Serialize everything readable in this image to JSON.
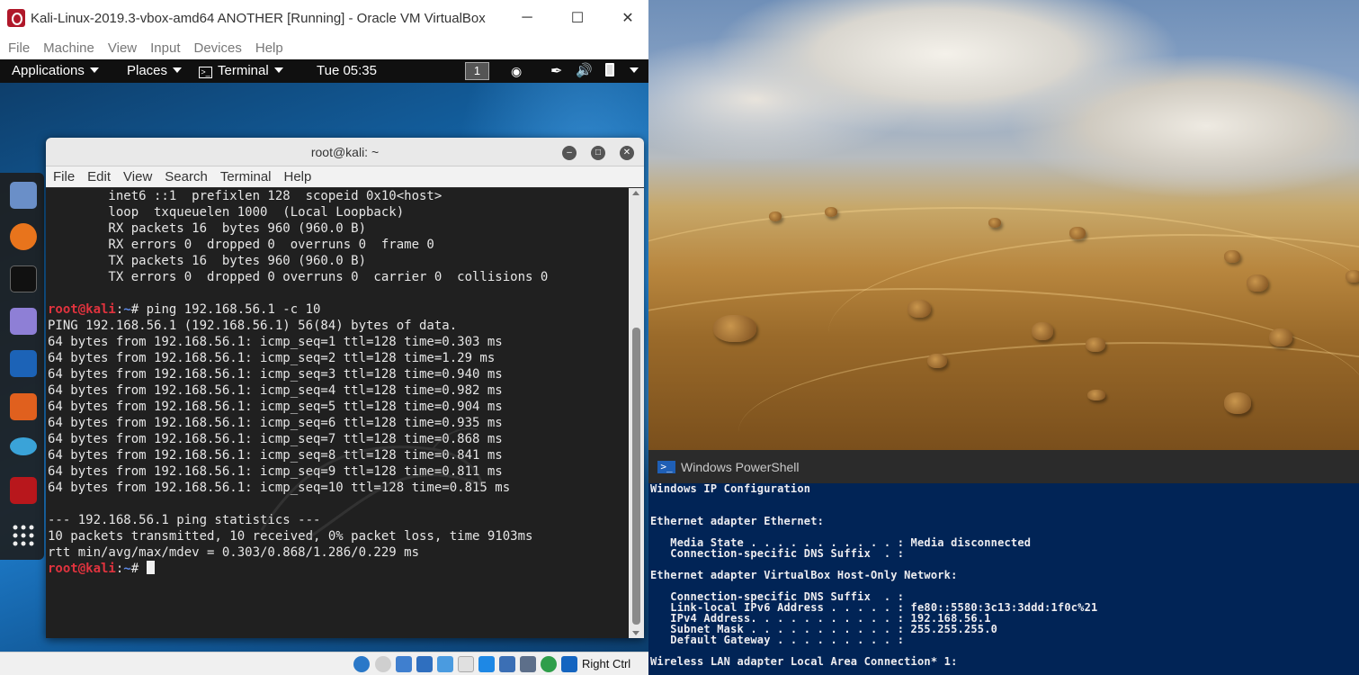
{
  "vbox": {
    "title": "Kali-Linux-2019.3-vbox-amd64 ANOTHER [Running] - Oracle VM VirtualBox",
    "window_controls": [
      "─",
      "☐",
      "✕"
    ],
    "menu": [
      "File",
      "Machine",
      "View",
      "Input",
      "Devices",
      "Help"
    ],
    "host_key": "Right Ctrl"
  },
  "kali_topbar": {
    "applications": "Applications",
    "places": "Places",
    "terminal": "Terminal",
    "clock": "Tue 05:35",
    "workspace": "1"
  },
  "dock": {
    "items": [
      "files-icon",
      "firefox-icon",
      "terminal-icon",
      "notes-icon",
      "metasploit-icon",
      "burpsuite-icon",
      "eye-icon",
      "cherrytree-icon",
      "app-grid-icon"
    ]
  },
  "terminal": {
    "title": "root@kali: ~",
    "menu": [
      "File",
      "Edit",
      "View",
      "Search",
      "Terminal",
      "Help"
    ],
    "lines_top": [
      "        inet6 ::1  prefixlen 128  scopeid 0x10<host>",
      "        loop  txqueuelen 1000  (Local Loopback)",
      "        RX packets 16  bytes 960 (960.0 B)",
      "        RX errors 0  dropped 0  overruns 0  frame 0",
      "        TX packets 16  bytes 960 (960.0 B)",
      "        TX errors 0  dropped 0 overruns 0  carrier 0  collisions 0",
      ""
    ],
    "prompt_user": "root@kali",
    "prompt_sep": ":",
    "prompt_path": "~",
    "prompt_symbol": "# ",
    "command": "ping 192.168.56.1 -c 10",
    "output": [
      "PING 192.168.56.1 (192.168.56.1) 56(84) bytes of data.",
      "64 bytes from 192.168.56.1: icmp_seq=1 ttl=128 time=0.303 ms",
      "64 bytes from 192.168.56.1: icmp_seq=2 ttl=128 time=1.29 ms",
      "64 bytes from 192.168.56.1: icmp_seq=3 ttl=128 time=0.940 ms",
      "64 bytes from 192.168.56.1: icmp_seq=4 ttl=128 time=0.982 ms",
      "64 bytes from 192.168.56.1: icmp_seq=5 ttl=128 time=0.904 ms",
      "64 bytes from 192.168.56.1: icmp_seq=6 ttl=128 time=0.935 ms",
      "64 bytes from 192.168.56.1: icmp_seq=7 ttl=128 time=0.868 ms",
      "64 bytes from 192.168.56.1: icmp_seq=8 ttl=128 time=0.841 ms",
      "64 bytes from 192.168.56.1: icmp_seq=9 ttl=128 time=0.811 ms",
      "64 bytes from 192.168.56.1: icmp_seq=10 ttl=128 time=0.815 ms",
      "",
      "--- 192.168.56.1 ping statistics ---",
      "10 packets transmitted, 10 received, 0% packet loss, time 9103ms",
      "rtt min/avg/max/mdev = 0.303/0.868/1.286/0.229 ms"
    ]
  },
  "powershell": {
    "title": "Windows PowerShell",
    "lines": [
      "Windows IP Configuration",
      "",
      "",
      "Ethernet adapter Ethernet:",
      "",
      "   Media State . . . . . . . . . . . : Media disconnected",
      "   Connection-specific DNS Suffix  . :",
      "",
      "Ethernet adapter VirtualBox Host-Only Network:",
      "",
      "   Connection-specific DNS Suffix  . :",
      "   Link-local IPv6 Address . . . . . : fe80::5580:3c13:3ddd:1f0c%21",
      "   IPv4 Address. . . . . . . . . . . : 192.168.56.1",
      "   Subnet Mask . . . . . . . . . . . : 255.255.255.0",
      "   Default Gateway . . . . . . . . . :",
      "",
      "Wireless LAN adapter Local Area Connection* 1:"
    ]
  },
  "colors": {
    "prompt_user": "#e0333e",
    "prompt_path": "#5e8ae6",
    "powershell_bg": "#012456"
  }
}
